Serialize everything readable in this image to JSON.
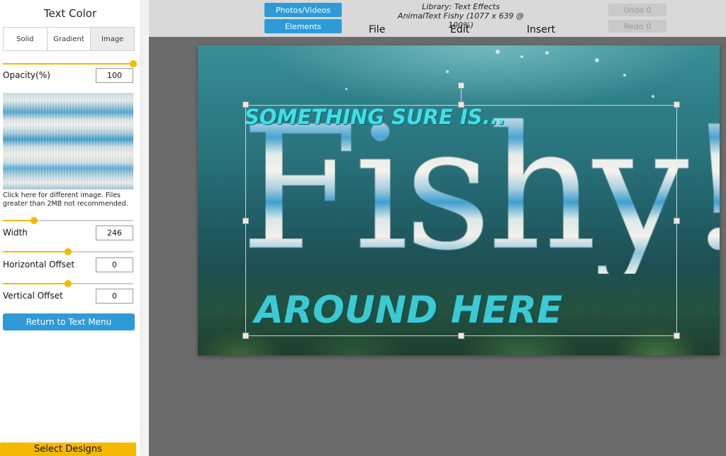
{
  "sidebar": {
    "title": "Text Color",
    "tabs": [
      {
        "label": "Solid",
        "active": false
      },
      {
        "label": "Gradient",
        "active": false
      },
      {
        "label": "Image",
        "active": true
      }
    ],
    "opacity": {
      "label": "Opacity(%)",
      "value": "100",
      "slider_fraction": 1.0
    },
    "swatch_help": "Click here for different image. Files greater than 2MB not recommended.",
    "width": {
      "label": "Width",
      "value": "246",
      "slider_fraction": 0.24
    },
    "horizontal_offset": {
      "label": "Horizontal Offset",
      "value": "0",
      "slider_fraction": 0.5
    },
    "vertical_offset": {
      "label": "Vertical Offset",
      "value": "0",
      "slider_fraction": 0.5
    },
    "return_label": "Return to Text Menu",
    "select_designs_label": "Select Designs"
  },
  "topbar": {
    "photos_videos_label": "Photos/Videos",
    "elements_label": "Elements",
    "library_line": "Library: Text Effects",
    "document_line": "AnimalText Fishy (1077 x 639 @ 100%)",
    "menu": {
      "file": "File",
      "edit": "Edit",
      "insert": "Insert"
    },
    "undo_label": "Undo 0",
    "redo_label": "Redo 0"
  },
  "canvas": {
    "line1": "SOMETHING SURE IS...",
    "line2": "Fishy!",
    "line3": "AROUND HERE"
  },
  "colors": {
    "accent_blue": "#2e9ad8",
    "accent_yellow": "#f5b800",
    "cyan_text": "#3fe0e6"
  }
}
